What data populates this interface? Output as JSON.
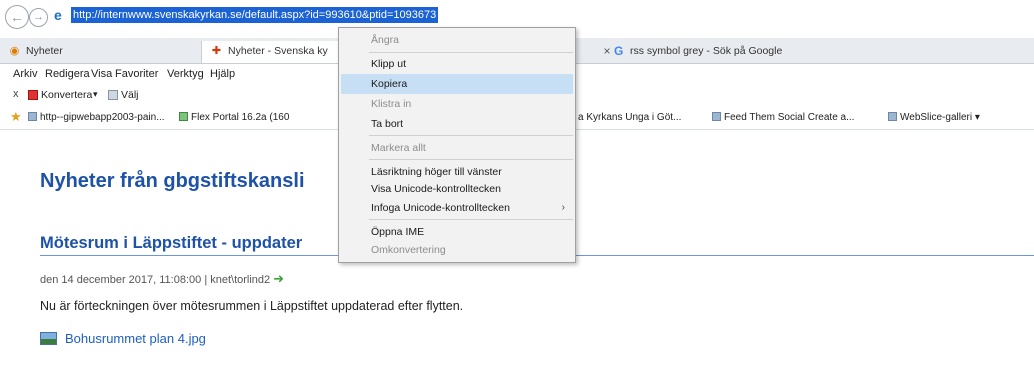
{
  "address_bar": {
    "url": "http://internwww.svenskakyrkan.se/default.aspx?id=993610&ptid=1093673"
  },
  "tabs": [
    {
      "title": "Nyheter",
      "icon": "rss-icon"
    },
    {
      "title": "Nyheter - Svenska ky",
      "icon": "svenska-kyrkan-cross-icon"
    },
    {
      "title": "rss symbol grey - Sök på Google",
      "icon": "google-icon"
    }
  ],
  "menu_bar": {
    "items": [
      "Arkiv",
      "Redigera",
      "Visa",
      "Favoriter",
      "Verktyg",
      "Hjälp"
    ]
  },
  "command_bar": {
    "close": "x",
    "konvertera": "Konvertera",
    "konvertera_arrow": "▾",
    "valj": "Välj"
  },
  "favorites_bar": {
    "items": [
      "http--gipwebapp2003-pain...",
      "Flex Portal 16.2a (160",
      "a Kyrkans Unga i Göt...",
      "Feed Them Social  Create a...",
      "WebSlice-galleri ▾"
    ]
  },
  "content": {
    "page_title": "Nyheter från gbgstiftskansli",
    "article_title": "Mötesrum i Läppstiftet - uppdater",
    "meta": "den 14 december 2017, 11:08:00 | knet\\torlind2",
    "body": "Nu är förteckningen över mötesrummen i Läppstiftet uppdaterad efter flytten.",
    "attachment": "Bohusrummet plan 4.jpg"
  },
  "context_menu": {
    "items": [
      {
        "label": "Ångra",
        "disabled": true
      },
      {
        "label": "Klipp ut",
        "disabled": false
      },
      {
        "label": "Kopiera",
        "disabled": false,
        "highlighted": true
      },
      {
        "label": "Klistra in",
        "disabled": true
      },
      {
        "label": "Ta bort",
        "disabled": false
      },
      {
        "label": "Markera allt",
        "disabled": true
      },
      {
        "label": "Läsriktning höger till vänster",
        "disabled": false
      },
      {
        "label": "Visa Unicode-kontrolltecken",
        "disabled": false
      },
      {
        "label": "Infoga Unicode-kontrolltecken",
        "disabled": false,
        "submenu": true
      },
      {
        "label": "Öppna IME",
        "disabled": false
      },
      {
        "label": "Omkonvertering",
        "disabled": true
      }
    ]
  },
  "colors": {
    "link_blue": "#1d52a8",
    "selection_blue": "#1b62d4",
    "menu_highlight": "#c7dff5"
  }
}
